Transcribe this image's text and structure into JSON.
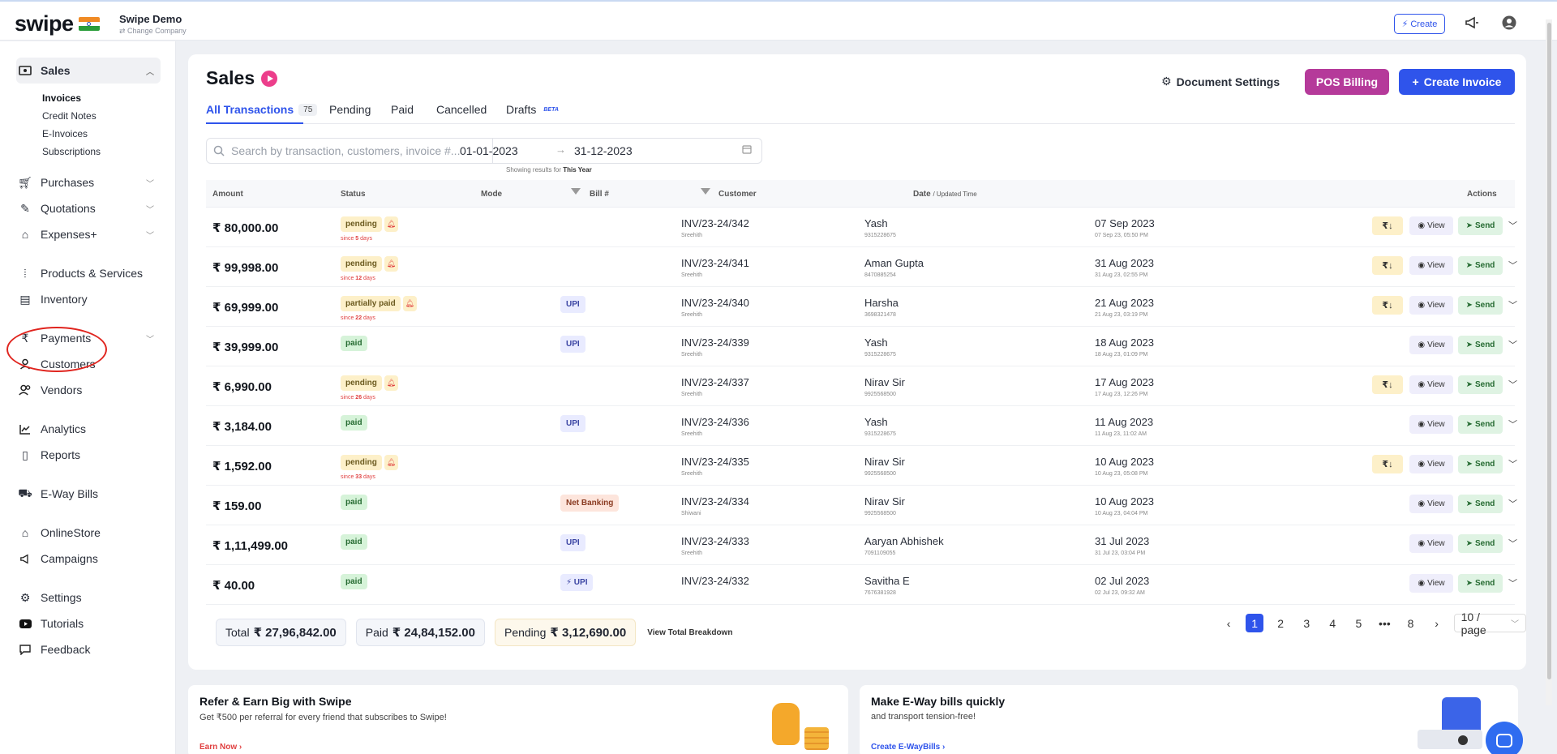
{
  "topbar": {
    "logo": "swipe",
    "company_name": "Swipe Demo",
    "change_company": "Change Company",
    "create_label": "Create"
  },
  "sidebar": {
    "sales": "Sales",
    "sales_sub": [
      "Invoices",
      "Credit Notes",
      "E-Invoices",
      "Subscriptions"
    ],
    "purchases": "Purchases",
    "quotations": "Quotations",
    "expenses": "Expenses+",
    "products": "Products & Services",
    "inventory": "Inventory",
    "payments": "Payments",
    "customers": "Customers",
    "vendors": "Vendors",
    "analytics": "Analytics",
    "reports": "Reports",
    "eway": "E-Way Bills",
    "onlinestore": "OnlineStore",
    "campaigns": "Campaigns",
    "settings": "Settings",
    "tutorials": "Tutorials",
    "feedback": "Feedback"
  },
  "main": {
    "title": "Sales",
    "doc_settings": "Document Settings",
    "pos_billing": "POS Billing",
    "create_invoice": "Create Invoice",
    "tabs": {
      "all": "All Transactions",
      "all_count": "75",
      "pending": "Pending",
      "paid": "Paid",
      "cancelled": "Cancelled",
      "drafts": "Drafts",
      "beta": "BETA"
    },
    "search_placeholder": "Search by transaction, customers, invoice #...",
    "date_from": "01-01-2023",
    "date_to": "31-12-2023",
    "showing_prefix": "Showing results for",
    "showing_period": "This Year"
  },
  "table": {
    "headers": {
      "amount": "Amount",
      "status": "Status",
      "mode": "Mode",
      "bill": "Bill #",
      "customer": "Customer",
      "date": "Date",
      "date_sub": "/ Updated Time",
      "actions": "Actions"
    },
    "view_label": "View",
    "send_label": "Send",
    "rows": [
      {
        "amount": "₹ 80,000.00",
        "status": "pending",
        "since_pre": "since",
        "since_val": "5",
        "since_post": "days",
        "mode": "",
        "bill": "INV/23-24/342",
        "by": "Sreehith",
        "customer": "Yash",
        "phone": "9315228675",
        "date": "07 Sep 2023",
        "updated": "07 Sep 23, 05:50 PM"
      },
      {
        "amount": "₹ 99,998.00",
        "status": "pending",
        "since_pre": "since",
        "since_val": "12",
        "since_post": "days",
        "mode": "",
        "bill": "INV/23-24/341",
        "by": "Sreehith",
        "customer": "Aman Gupta",
        "phone": "8470885254",
        "date": "31 Aug 2023",
        "updated": "31 Aug 23, 02:55 PM"
      },
      {
        "amount": "₹ 69,999.00",
        "status": "partially paid",
        "since_pre": "since",
        "since_val": "22",
        "since_post": "days",
        "mode": "UPI",
        "bill": "INV/23-24/340",
        "by": "Sreehith",
        "customer": "Harsha",
        "phone": "3698321478",
        "date": "21 Aug 2023",
        "updated": "21 Aug 23, 03:19 PM"
      },
      {
        "amount": "₹ 39,999.00",
        "status": "paid",
        "since_pre": "",
        "since_val": "",
        "since_post": "",
        "mode": "UPI",
        "bill": "INV/23-24/339",
        "by": "Sreehith",
        "customer": "Yash",
        "phone": "9315228675",
        "date": "18 Aug 2023",
        "updated": "18 Aug 23, 01:09 PM"
      },
      {
        "amount": "₹ 6,990.00",
        "status": "pending",
        "since_pre": "since",
        "since_val": "26",
        "since_post": "days",
        "mode": "",
        "bill": "INV/23-24/337",
        "by": "Sreehith",
        "customer": "Nirav Sir",
        "phone": "9925568500",
        "date": "17 Aug 2023",
        "updated": "17 Aug 23, 12:26 PM"
      },
      {
        "amount": "₹ 3,184.00",
        "status": "paid",
        "since_pre": "",
        "since_val": "",
        "since_post": "",
        "mode": "UPI",
        "bill": "INV/23-24/336",
        "by": "Sreehith",
        "customer": "Yash",
        "phone": "9315228675",
        "date": "11 Aug 2023",
        "updated": "11 Aug 23, 11:02 AM"
      },
      {
        "amount": "₹ 1,592.00",
        "status": "pending",
        "since_pre": "since",
        "since_val": "33",
        "since_post": "days",
        "mode": "",
        "bill": "INV/23-24/335",
        "by": "Sreehith",
        "customer": "Nirav Sir",
        "phone": "9925568500",
        "date": "10 Aug 2023",
        "updated": "10 Aug 23, 05:08 PM"
      },
      {
        "amount": "₹ 159.00",
        "status": "paid",
        "since_pre": "",
        "since_val": "",
        "since_post": "",
        "mode": "Net Banking",
        "bill": "INV/23-24/334",
        "by": "Shiwani",
        "customer": "Nirav Sir",
        "phone": "9925568500",
        "date": "10 Aug 2023",
        "updated": "10 Aug 23, 04:04 PM"
      },
      {
        "amount": "₹ 1,11,499.00",
        "status": "paid",
        "since_pre": "",
        "since_val": "",
        "since_post": "",
        "mode": "UPI",
        "bill": "INV/23-24/333",
        "by": "Sreehith",
        "customer": "Aaryan Abhishek",
        "phone": "7091109055",
        "date": "31 Jul 2023",
        "updated": "31 Jul 23, 03:04 PM"
      },
      {
        "amount": "₹ 40.00",
        "status": "paid",
        "since_pre": "",
        "since_val": "",
        "since_post": "",
        "mode": "⚡ UPI",
        "bill": "INV/23-24/332",
        "by": "",
        "customer": "Savitha E",
        "phone": "7676381928",
        "date": "02 Jul 2023",
        "updated": "02 Jul 23, 09:32 AM"
      }
    ]
  },
  "totals": {
    "total_label": "Total",
    "total": "₹ 27,96,842.00",
    "paid_label": "Paid",
    "paid": "₹ 24,84,152.00",
    "pending_label": "Pending",
    "pending": "₹ 3,12,690.00",
    "breakdown": "View Total Breakdown"
  },
  "pagination": {
    "pages": [
      "1",
      "2",
      "3",
      "4",
      "5",
      "•••",
      "8"
    ],
    "page_size": "10 / page"
  },
  "promos": {
    "refer_title": "Refer & Earn Big with Swipe",
    "refer_desc": "Get ₹500 per referral for every friend that subscribes to Swipe!",
    "refer_link": "Earn Now",
    "eway_title": "Make E-Way bills quickly",
    "eway_desc": "and transport tension-free!",
    "eway_link": "Create E-WayBills"
  }
}
